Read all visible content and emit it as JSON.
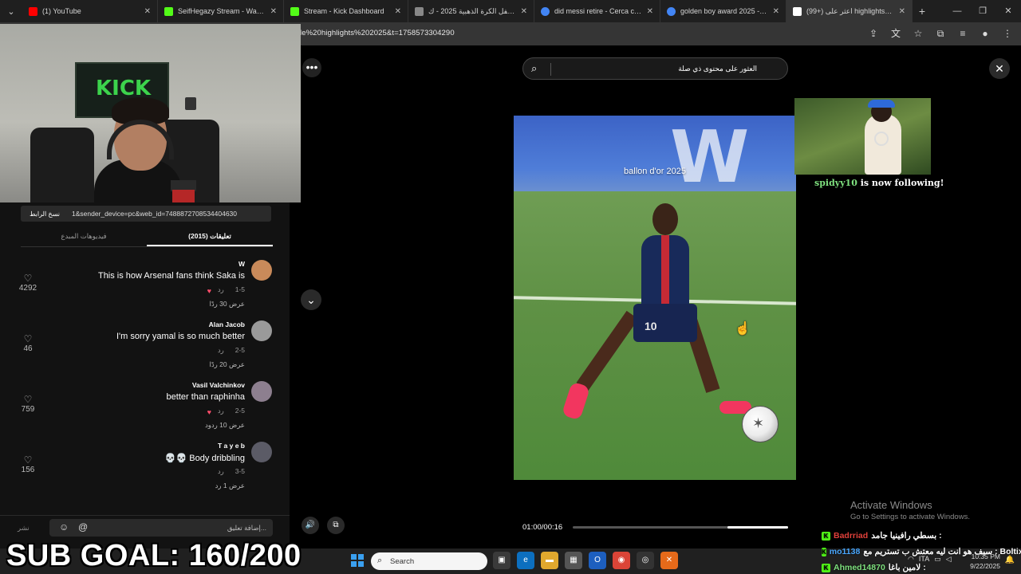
{
  "browser": {
    "tabs": [
      {
        "title": "(1) YouTube",
        "favicon": "youtube-icon",
        "color": "#ff0000"
      },
      {
        "title": "SeifHegazy Stream - Watch Live",
        "favicon": "kick-icon",
        "color": "#53fc18"
      },
      {
        "title": "Stream - Kick Dashboard",
        "favicon": "kick-icon",
        "color": "#53fc18"
      },
      {
        "title": "نتائج حفل الكرة الذهبية 2025 - ك",
        "favicon": "site-icon",
        "color": "#888888"
      },
      {
        "title": "did messi retire - Cerca con Go",
        "favicon": "google-icon",
        "color": "#4285f4"
      },
      {
        "title": "golden boy award 2025 - Cerca",
        "favicon": "google-icon",
        "color": "#4285f4"
      },
      {
        "title": "(99+) اعثر على highlights 2025'",
        "favicon": "tiktok-icon",
        "color": "#ffffff"
      }
    ],
    "new_tab": "+",
    "url": "le%20highlights%202025&t=1758573304290"
  },
  "tiktok_panel": {
    "copy_link": "نسخ الرابط",
    "share_link": "1&sender_device=pc&web_id=7488872708534404630",
    "tabs": {
      "comments": "(2015) تعليقات",
      "creator_videos": "فيديوهات المبدع"
    },
    "comments": [
      {
        "user": "W",
        "text": "This is how Arsenal fans think Saka is",
        "date": "1-5",
        "reply": "رد",
        "replies": "عرض 30 ردًا",
        "likes": "4292",
        "creator_liked": true
      },
      {
        "user": "Alan Jacob",
        "text": "I'm sorry yamal is so much better",
        "date": "2-5",
        "reply": "رد",
        "replies": "عرض 20 ردًا",
        "likes": "46",
        "creator_liked": false
      },
      {
        "user": "Vasil Valchinkov",
        "text": "better than raphinha",
        "date": "2-5",
        "reply": "رد",
        "replies": "عرض 10 ردود",
        "likes": "759",
        "creator_liked": true
      },
      {
        "user": "T a y e b",
        "text": "💀💀 Body dribbling",
        "date": "3-5",
        "reply": "رد",
        "replies": "عرض 1 رد",
        "likes": "156",
        "creator_liked": false
      }
    ],
    "comment_placeholder": "إضافة تعليق...",
    "post_label": "نشر"
  },
  "player": {
    "search_placeholder": "العثور على محتوى ذي صلة",
    "caption": "ballon d'or 2025",
    "current_time": "01:00",
    "duration": "00:16",
    "progress_fraction": 0.72,
    "shirt_number": "10"
  },
  "overlay": {
    "sub_goal": "SUB GOAL: 160/200",
    "follower_name": "spidyy10",
    "follower_text": " is now following!",
    "activate_title": "Activate Windows",
    "activate_sub": "Go to Settings to activate Windows."
  },
  "chat": [
    {
      "user": "Badrriad",
      "user_color": "#e0403a",
      "message": "بسطي رافينيا جامد :"
    },
    {
      "user": "mo1138",
      "user_color": "#4aa8ff",
      "message": "سيف هو انت ليه معتش ب تستريم مع : Boltix"
    },
    {
      "user": "Ahmed14870",
      "user_color": "#7ee07e",
      "message": "لامين باغا :"
    }
  ],
  "taskbar": {
    "search_placeholder": "Search",
    "language": "ITA",
    "time": "10:35 PM",
    "date": "9/22/2025"
  }
}
